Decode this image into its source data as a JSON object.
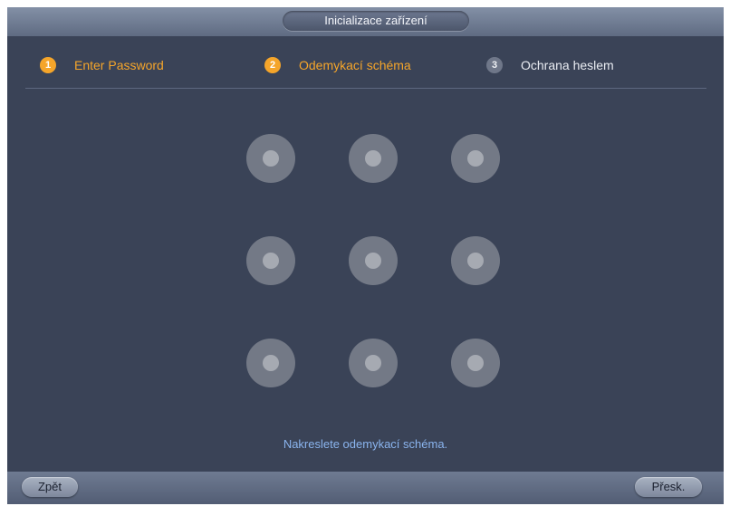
{
  "window": {
    "title": "Inicializace zařízení"
  },
  "steps": [
    {
      "number": "1",
      "label": "Enter Password",
      "state": "active"
    },
    {
      "number": "2",
      "label": "Odemykací schéma",
      "state": "active"
    },
    {
      "number": "3",
      "label": "Ochrana heslem",
      "state": "inactive"
    }
  ],
  "pattern": {
    "rows": 3,
    "columns": 3,
    "hint": "Nakreslete odemykací schéma."
  },
  "footer": {
    "back_label": "Zpět",
    "skip_label": "Přesk."
  },
  "colors": {
    "accent": "#f5a52a",
    "background": "#3a4357",
    "hint": "#8ab4ee"
  }
}
